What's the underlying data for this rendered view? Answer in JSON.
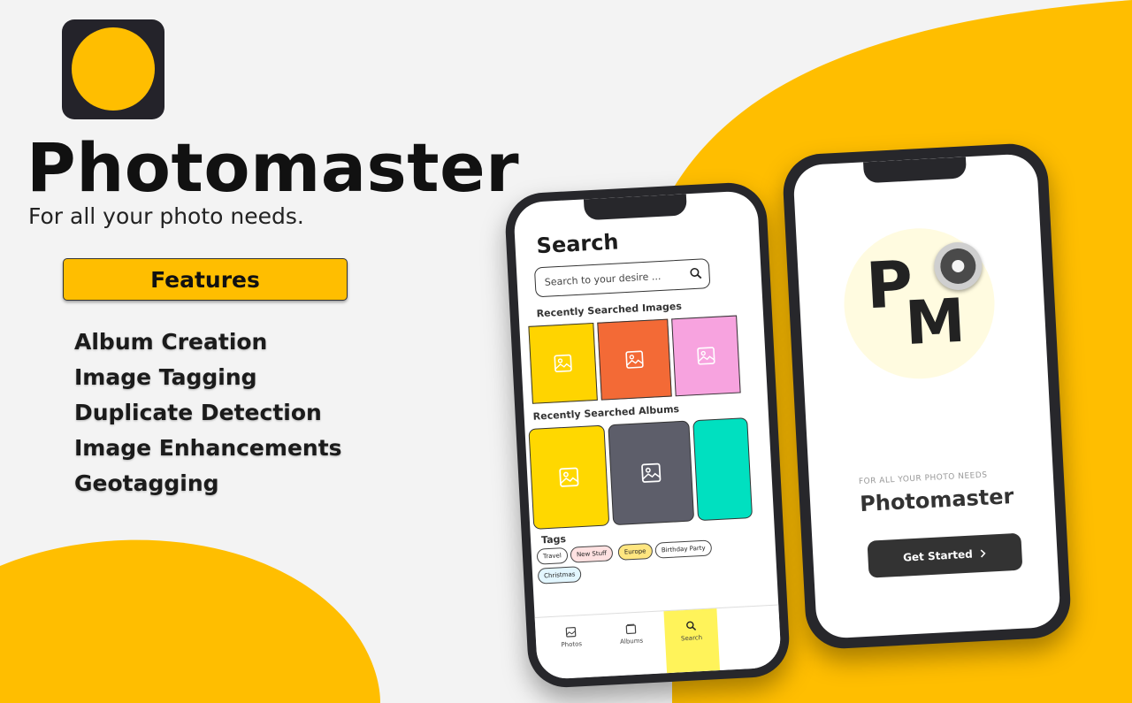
{
  "brand": {
    "title": "Photomaster",
    "tagline": "For all your photo needs.",
    "accent_color": "#FFBE00"
  },
  "features": {
    "label": "Features",
    "items": [
      "Album Creation",
      "Image Tagging",
      "Duplicate Detection",
      "Image Enhancements",
      "Geotagging"
    ]
  },
  "search_screen": {
    "title": "Search",
    "search_placeholder": "Search to your desire ...",
    "recent_images_label": "Recently Searched Images",
    "recent_albums_label": "Recently Searched Albums",
    "tags_label": "Tags",
    "tags": [
      "Travel",
      "New Stuff",
      "Europe",
      "Birthday Party",
      "Christmas"
    ],
    "tabs": [
      "Photos",
      "Albums",
      "Search"
    ],
    "active_tab": "Search"
  },
  "welcome_screen": {
    "logo_letters": "PM",
    "subtitle": "FOR ALL YOUR PHOTO NEEDS",
    "title": "Photomaster",
    "cta_label": "Get Started",
    "cta_icon": "chevron-right-icon"
  }
}
